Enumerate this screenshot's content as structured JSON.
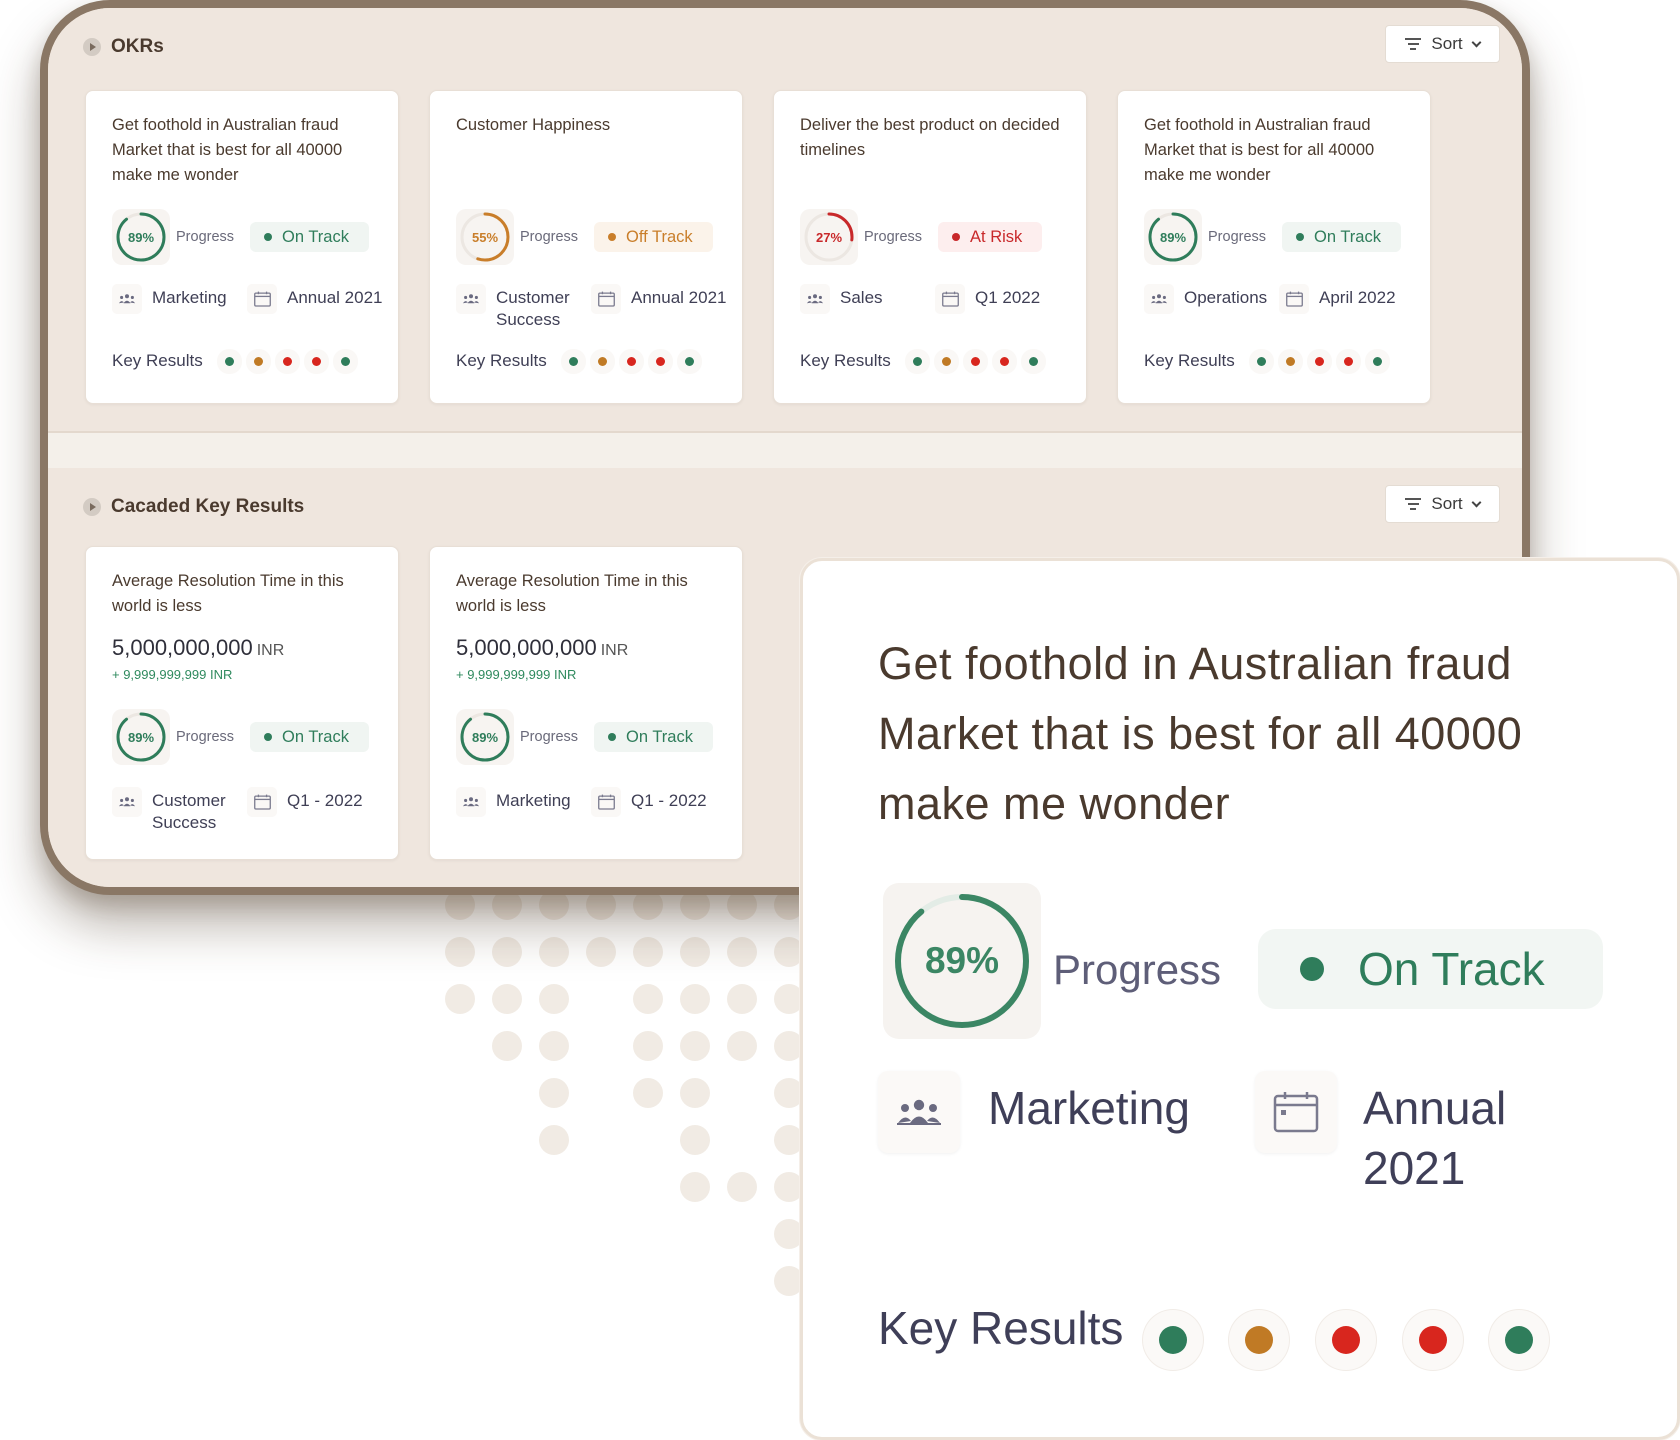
{
  "okrs_section": {
    "title": "OKRs",
    "sort_label": "Sort",
    "cards": [
      {
        "title": "Get foothold in Australian fraud Market that is best for all 40000 make  me wonder",
        "progress": "89%",
        "progress_value": 0.89,
        "progress_label": "Progress",
        "status": "On Track",
        "status_color": "#2f7d5b",
        "status_bg": "#f0f5f2",
        "team": "Marketing",
        "period": "Annual 2021",
        "kr_label": "Key Results",
        "key_results": [
          "#2f7d5b",
          "#c07a25",
          "#d8261e",
          "#d8261e",
          "#2f7d5b"
        ]
      },
      {
        "title": "Customer Happiness",
        "progress": "55%",
        "progress_value": 0.55,
        "progress_label": "Progress",
        "status": "Off Track",
        "status_color": "#c97e2a",
        "status_bg": "#fbf3ea",
        "team": "Customer Success",
        "period": "Annual 2021",
        "kr_label": "Key Results",
        "key_results": [
          "#2f7d5b",
          "#c07a25",
          "#d8261e",
          "#d8261e",
          "#2f7d5b"
        ]
      },
      {
        "title": "Deliver the best product on decided timelines",
        "progress": "27%",
        "progress_value": 0.27,
        "progress_label": "Progress",
        "status": "At Risk",
        "status_color": "#c8282a",
        "status_bg": "#fdeeee",
        "team": "Sales",
        "period": "Q1 2022",
        "kr_label": "Key Results",
        "key_results": [
          "#2f7d5b",
          "#c07a25",
          "#d8261e",
          "#d8261e",
          "#2f7d5b"
        ]
      },
      {
        "title": "Get foothold in Australian fraud Market that is best for all 40000 make  me wonder",
        "progress": "89%",
        "progress_value": 0.89,
        "progress_label": "Progress",
        "status": "On Track",
        "status_color": "#2f7d5b",
        "status_bg": "#f0f5f2",
        "team": "Operations",
        "period": "April 2022",
        "kr_label": "Key Results",
        "key_results": [
          "#2f7d5b",
          "#c07a25",
          "#d8261e",
          "#d8261e",
          "#2f7d5b"
        ]
      }
    ]
  },
  "cascaded_section": {
    "title": "Cacaded Key Results",
    "sort_label": "Sort",
    "cards": [
      {
        "title": "Average Resolution Time in this world is less",
        "amount": "5,000,000,000",
        "unit": "INR",
        "delta": "+ 9,999,999,999 INR",
        "progress": "89%",
        "progress_value": 0.89,
        "progress_label": "Progress",
        "status": "On Track",
        "status_color": "#2f7d5b",
        "status_bg": "#f0f5f2",
        "team": "Customer Success",
        "period": "Q1 - 2022"
      },
      {
        "title": "Average Resolution Time in this world is less",
        "amount": "5,000,000,000",
        "unit": "INR",
        "delta": "+ 9,999,999,999 INR",
        "progress": "89%",
        "progress_value": 0.89,
        "progress_label": "Progress",
        "status": "On Track",
        "status_color": "#2f7d5b",
        "status_bg": "#f0f5f2",
        "team": "Marketing",
        "period": "Q1 - 2022"
      }
    ]
  },
  "zoom_card": {
    "title": "Get foothold in Australian fraud Market that is best for all 40000 make  me wonder",
    "progress": "89%",
    "progress_value": 0.89,
    "progress_label": "Progress",
    "status": "On Track",
    "team": "Marketing",
    "period": "Annual 2021",
    "kr_label": "Key Results",
    "key_results": [
      "#2f7d5b",
      "#c07a25",
      "#d8261e",
      "#d8261e",
      "#2f7d5b"
    ]
  },
  "icons": {
    "section_toggle": "play-icon",
    "sort": "filter-icon",
    "sort_caret": "chevron-down-icon",
    "team": "team-icon",
    "period": "calendar-icon"
  },
  "colors": {
    "page_bg": "#efe6de",
    "frame": "#8a7765",
    "on_track": "#2f7d5b",
    "off_track": "#c97e2a",
    "at_risk": "#c8282a"
  }
}
